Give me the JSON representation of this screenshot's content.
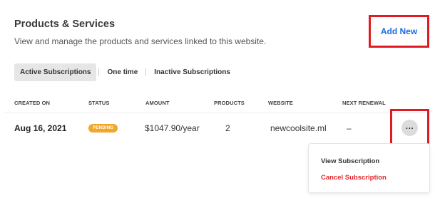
{
  "header": {
    "title": "Products & Services",
    "subtitle": "View and manage the products and services linked to this website.",
    "add_new_label": "Add New"
  },
  "tabs": [
    {
      "label": "Active Subscriptions",
      "active": true
    },
    {
      "label": "One time",
      "active": false
    },
    {
      "label": "Inactive Subscriptions",
      "active": false
    }
  ],
  "table": {
    "columns": [
      "CREATED ON",
      "STATUS",
      "AMOUNT",
      "PRODUCTS",
      "WEBSITE",
      "NEXT RENEWAL"
    ],
    "rows": [
      {
        "created_on": "Aug 16, 2021",
        "status": "PENDING",
        "amount": "$1047.90/year",
        "products": "2",
        "website": "newcoolsite.ml",
        "next_renewal": "–"
      }
    ]
  },
  "row_menu": {
    "button_glyph": "...",
    "items": [
      "View Subscription",
      "Cancel Subscription"
    ]
  },
  "colors": {
    "accent": "#1d6ce0",
    "status_pending": "#f1a82a",
    "danger": "#e0282e",
    "highlight_box": "#e01b24"
  }
}
